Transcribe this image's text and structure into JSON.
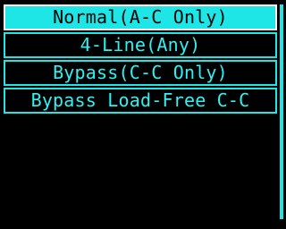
{
  "menu": {
    "items": [
      {
        "label": "Normal(A-C Only)",
        "selected": true
      },
      {
        "label": "4-Line(Any)",
        "selected": false
      },
      {
        "label": "Bypass(C-C Only)",
        "selected": false
      },
      {
        "label": "Bypass Load-Free C-C",
        "selected": false
      }
    ]
  },
  "colors": {
    "background": "#000000",
    "accent": "#1ee6e6",
    "text": "#2ff2f2",
    "selected_text": "#000000",
    "selected_border": "#ffffff"
  }
}
